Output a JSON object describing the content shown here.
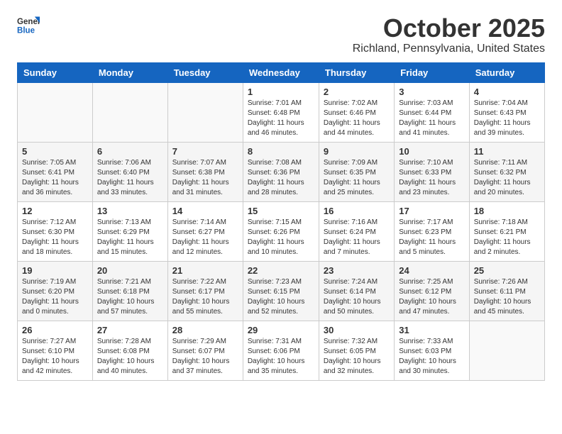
{
  "header": {
    "logo_general": "General",
    "logo_blue": "Blue",
    "month_title": "October 2025",
    "location": "Richland, Pennsylvania, United States"
  },
  "days_of_week": [
    "Sunday",
    "Monday",
    "Tuesday",
    "Wednesday",
    "Thursday",
    "Friday",
    "Saturday"
  ],
  "weeks": [
    [
      {
        "day": "",
        "info": ""
      },
      {
        "day": "",
        "info": ""
      },
      {
        "day": "",
        "info": ""
      },
      {
        "day": "1",
        "info": "Sunrise: 7:01 AM\nSunset: 6:48 PM\nDaylight: 11 hours\nand 46 minutes."
      },
      {
        "day": "2",
        "info": "Sunrise: 7:02 AM\nSunset: 6:46 PM\nDaylight: 11 hours\nand 44 minutes."
      },
      {
        "day": "3",
        "info": "Sunrise: 7:03 AM\nSunset: 6:44 PM\nDaylight: 11 hours\nand 41 minutes."
      },
      {
        "day": "4",
        "info": "Sunrise: 7:04 AM\nSunset: 6:43 PM\nDaylight: 11 hours\nand 39 minutes."
      }
    ],
    [
      {
        "day": "5",
        "info": "Sunrise: 7:05 AM\nSunset: 6:41 PM\nDaylight: 11 hours\nand 36 minutes."
      },
      {
        "day": "6",
        "info": "Sunrise: 7:06 AM\nSunset: 6:40 PM\nDaylight: 11 hours\nand 33 minutes."
      },
      {
        "day": "7",
        "info": "Sunrise: 7:07 AM\nSunset: 6:38 PM\nDaylight: 11 hours\nand 31 minutes."
      },
      {
        "day": "8",
        "info": "Sunrise: 7:08 AM\nSunset: 6:36 PM\nDaylight: 11 hours\nand 28 minutes."
      },
      {
        "day": "9",
        "info": "Sunrise: 7:09 AM\nSunset: 6:35 PM\nDaylight: 11 hours\nand 25 minutes."
      },
      {
        "day": "10",
        "info": "Sunrise: 7:10 AM\nSunset: 6:33 PM\nDaylight: 11 hours\nand 23 minutes."
      },
      {
        "day": "11",
        "info": "Sunrise: 7:11 AM\nSunset: 6:32 PM\nDaylight: 11 hours\nand 20 minutes."
      }
    ],
    [
      {
        "day": "12",
        "info": "Sunrise: 7:12 AM\nSunset: 6:30 PM\nDaylight: 11 hours\nand 18 minutes."
      },
      {
        "day": "13",
        "info": "Sunrise: 7:13 AM\nSunset: 6:29 PM\nDaylight: 11 hours\nand 15 minutes."
      },
      {
        "day": "14",
        "info": "Sunrise: 7:14 AM\nSunset: 6:27 PM\nDaylight: 11 hours\nand 12 minutes."
      },
      {
        "day": "15",
        "info": "Sunrise: 7:15 AM\nSunset: 6:26 PM\nDaylight: 11 hours\nand 10 minutes."
      },
      {
        "day": "16",
        "info": "Sunrise: 7:16 AM\nSunset: 6:24 PM\nDaylight: 11 hours\nand 7 minutes."
      },
      {
        "day": "17",
        "info": "Sunrise: 7:17 AM\nSunset: 6:23 PM\nDaylight: 11 hours\nand 5 minutes."
      },
      {
        "day": "18",
        "info": "Sunrise: 7:18 AM\nSunset: 6:21 PM\nDaylight: 11 hours\nand 2 minutes."
      }
    ],
    [
      {
        "day": "19",
        "info": "Sunrise: 7:19 AM\nSunset: 6:20 PM\nDaylight: 11 hours\nand 0 minutes."
      },
      {
        "day": "20",
        "info": "Sunrise: 7:21 AM\nSunset: 6:18 PM\nDaylight: 10 hours\nand 57 minutes."
      },
      {
        "day": "21",
        "info": "Sunrise: 7:22 AM\nSunset: 6:17 PM\nDaylight: 10 hours\nand 55 minutes."
      },
      {
        "day": "22",
        "info": "Sunrise: 7:23 AM\nSunset: 6:15 PM\nDaylight: 10 hours\nand 52 minutes."
      },
      {
        "day": "23",
        "info": "Sunrise: 7:24 AM\nSunset: 6:14 PM\nDaylight: 10 hours\nand 50 minutes."
      },
      {
        "day": "24",
        "info": "Sunrise: 7:25 AM\nSunset: 6:12 PM\nDaylight: 10 hours\nand 47 minutes."
      },
      {
        "day": "25",
        "info": "Sunrise: 7:26 AM\nSunset: 6:11 PM\nDaylight: 10 hours\nand 45 minutes."
      }
    ],
    [
      {
        "day": "26",
        "info": "Sunrise: 7:27 AM\nSunset: 6:10 PM\nDaylight: 10 hours\nand 42 minutes."
      },
      {
        "day": "27",
        "info": "Sunrise: 7:28 AM\nSunset: 6:08 PM\nDaylight: 10 hours\nand 40 minutes."
      },
      {
        "day": "28",
        "info": "Sunrise: 7:29 AM\nSunset: 6:07 PM\nDaylight: 10 hours\nand 37 minutes."
      },
      {
        "day": "29",
        "info": "Sunrise: 7:31 AM\nSunset: 6:06 PM\nDaylight: 10 hours\nand 35 minutes."
      },
      {
        "day": "30",
        "info": "Sunrise: 7:32 AM\nSunset: 6:05 PM\nDaylight: 10 hours\nand 32 minutes."
      },
      {
        "day": "31",
        "info": "Sunrise: 7:33 AM\nSunset: 6:03 PM\nDaylight: 10 hours\nand 30 minutes."
      },
      {
        "day": "",
        "info": ""
      }
    ]
  ]
}
